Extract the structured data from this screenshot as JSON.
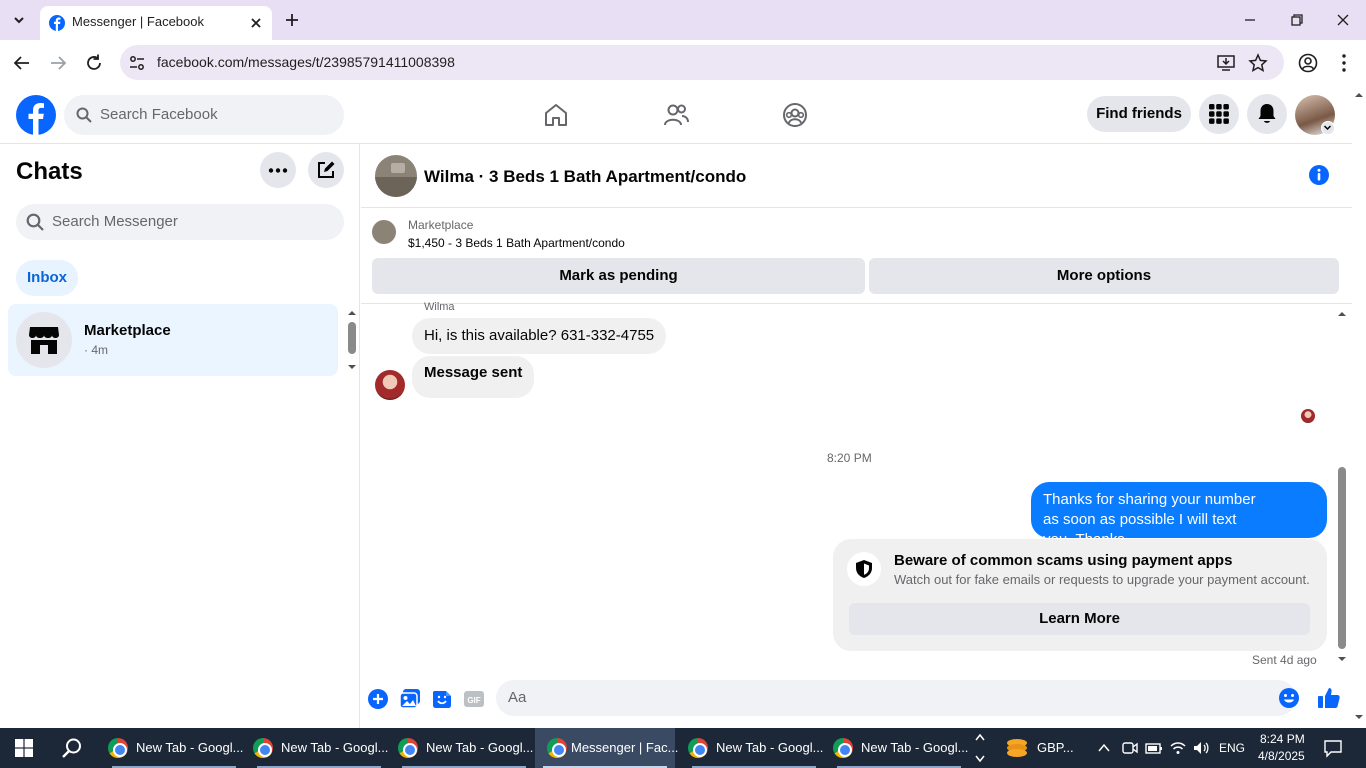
{
  "browser": {
    "tab_title": "Messenger | Facebook",
    "url": "facebook.com/messages/t/23985791411008398"
  },
  "fb_header": {
    "search_placeholder": "Search Facebook",
    "find_friends": "Find friends"
  },
  "left_panel": {
    "title": "Chats",
    "search_placeholder": "Search Messenger",
    "filter": "Inbox",
    "chats": [
      {
        "name": "Marketplace",
        "time": "· 4m"
      }
    ]
  },
  "conversation": {
    "title": "Wilma · 3 Beds 1 Bath Apartment/condo",
    "marketplace_label": "Marketplace",
    "listing": "$1,450 - 3 Beds 1 Bath Apartment/condo",
    "mark_pending": "Mark as pending",
    "more_options": "More options",
    "sender_name": "Wilma",
    "messages_in": [
      "Hi, is this available? 631-332-4755",
      "Message sent"
    ],
    "timestamp": "8:20 PM",
    "message_out_line1": "Thanks for sharing your number",
    "message_out_line2": "as soon as possible I will text you..Thanks",
    "scam_title": "Beware of common scams using payment apps",
    "scam_text": "Watch out for fake emails or requests to upgrade your payment account.",
    "learn_more": "Learn More",
    "sent_status": "Sent 4d ago",
    "composer_placeholder": "Aa"
  },
  "taskbar": {
    "tasks": [
      {
        "label": "New Tab - Googl..."
      },
      {
        "label": "New Tab - Googl..."
      },
      {
        "label": "New Tab - Googl..."
      },
      {
        "label": "Messenger | Fac..."
      },
      {
        "label": "New Tab - Googl..."
      },
      {
        "label": "New Tab - Googl..."
      }
    ],
    "currency": "GBP...",
    "lang": "ENG",
    "time": "8:24 PM",
    "date": "4/8/2025"
  },
  "colors": {
    "fb_blue": "#0866ff",
    "bubble_out": "#0a7cff",
    "tab_strip": "#e8dff5"
  }
}
